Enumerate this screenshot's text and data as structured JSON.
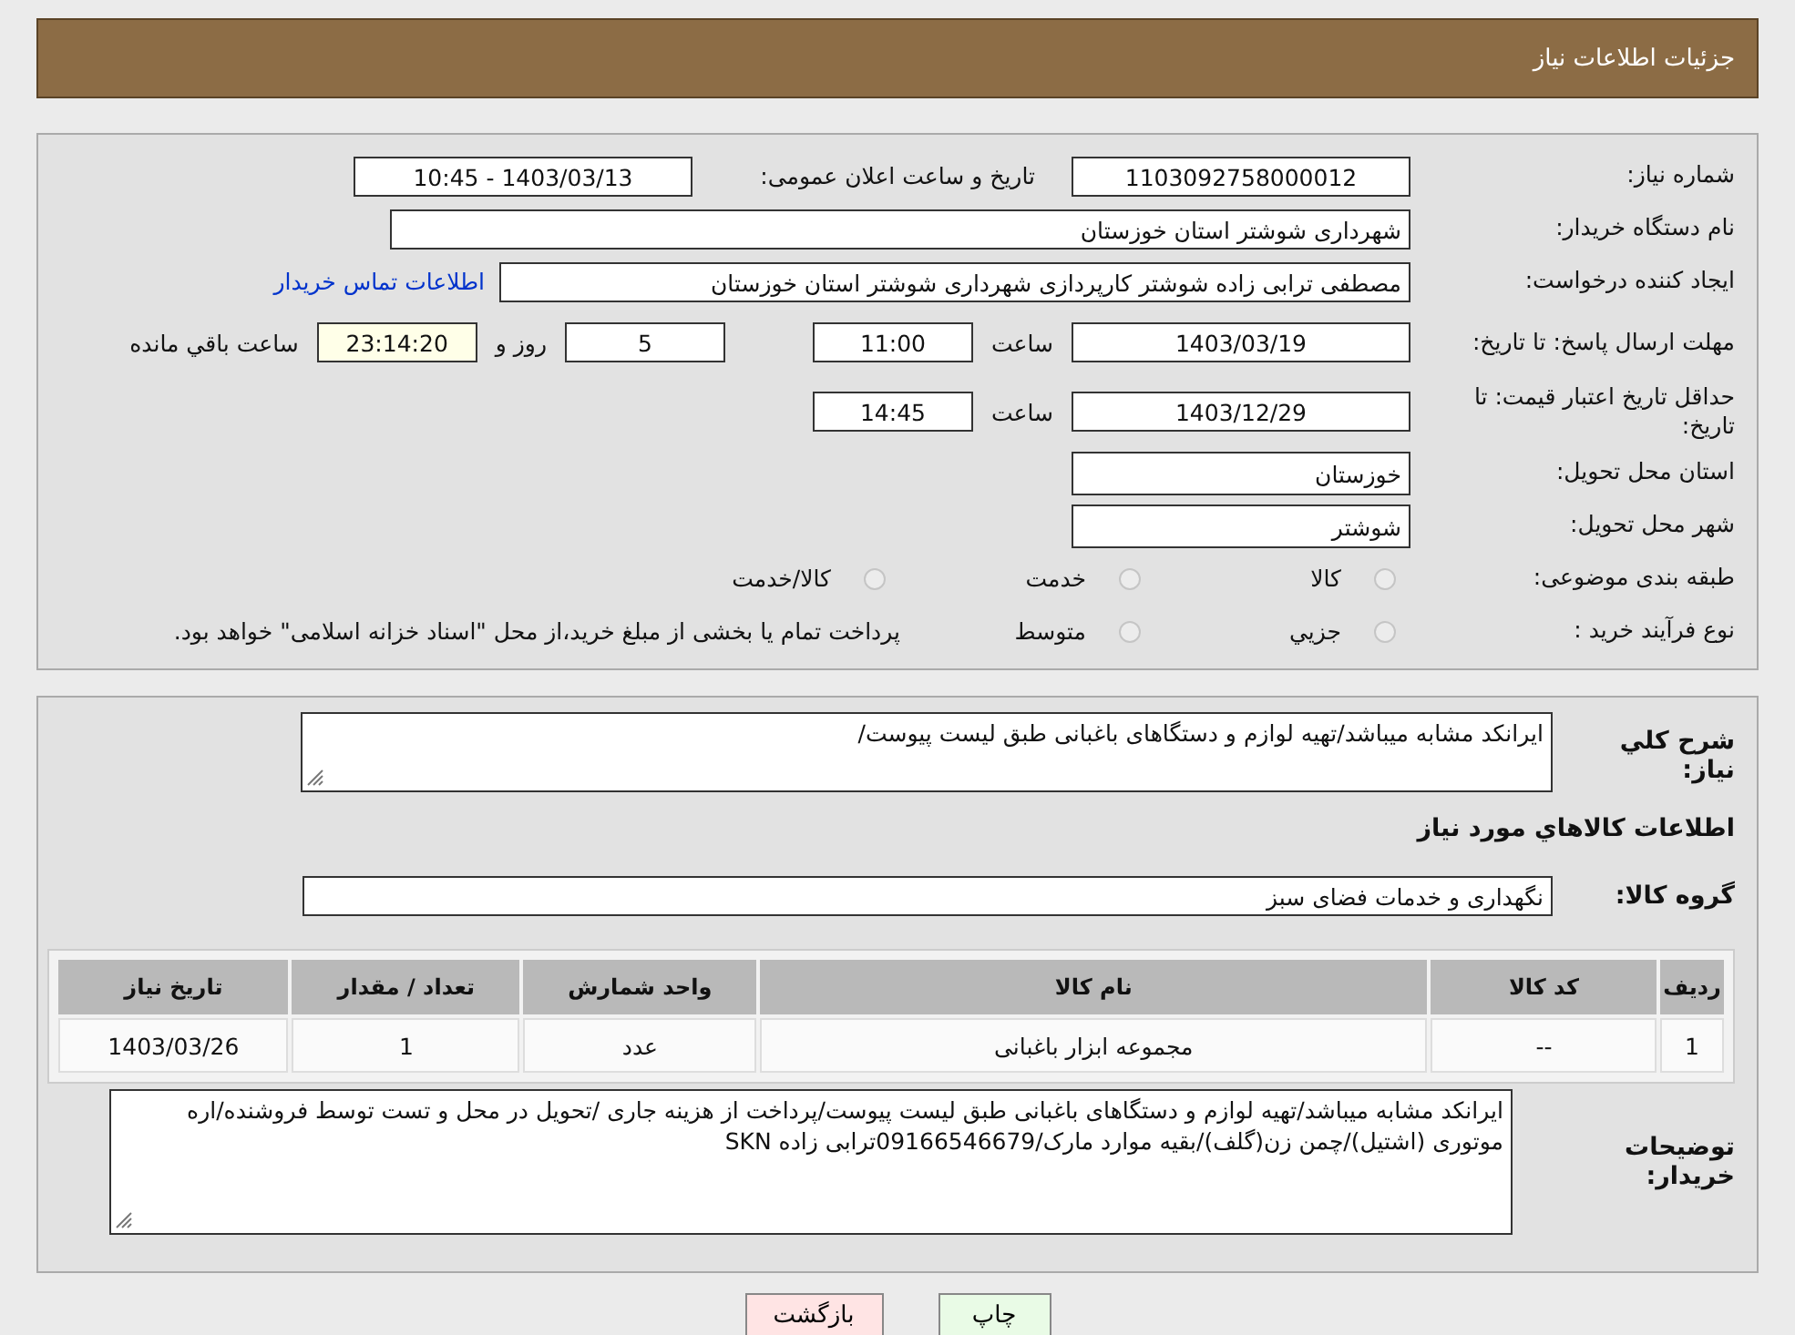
{
  "header": {
    "title": "جزئیات اطلاعات نیاز"
  },
  "details": {
    "need_number": {
      "label": "شماره نیاز:",
      "value": "1103092758000012"
    },
    "announce": {
      "label": "تاریخ و ساعت اعلان عمومی:",
      "value": "1403/03/13 - 10:45"
    },
    "buyer_org": {
      "label": "نام دستگاه خریدار:",
      "value": "شهرداری شوشتر استان خوزستان"
    },
    "requester": {
      "label": "ایجاد کننده درخواست:",
      "value": "مصطفی ترابی زاده شوشتر کارپردازی شهرداری شوشتر استان خوزستان",
      "link": "اطلاعات تماس خریدار"
    },
    "reply_deadline": {
      "label": "مهلت ارسال پاسخ: تا تاریخ:",
      "date": "1403/03/19",
      "time_label": "ساعت",
      "time": "11:00",
      "days": "5",
      "days_label": "روز و",
      "remaining": "23:14:20",
      "remaining_label": "ساعت باقي مانده"
    },
    "price_validity": {
      "label": "حداقل تاریخ اعتبار قیمت: تا تاریخ:",
      "date": "1403/12/29",
      "time_label": "ساعت",
      "time": "14:45"
    },
    "province": {
      "label": "استان محل تحویل:",
      "value": "خوزستان"
    },
    "city": {
      "label": "شهر محل تحویل:",
      "value": "شوشتر"
    },
    "category": {
      "label": "طبقه بندی موضوعی:",
      "options": [
        {
          "label": "كالا",
          "selected": false
        },
        {
          "label": "خدمت",
          "selected": false
        },
        {
          "label": "كالا/خدمت",
          "selected": false
        }
      ]
    },
    "purchase_type": {
      "label": "نوع فرآیند خرید :",
      "options": [
        {
          "label": "جزيي",
          "selected": false
        },
        {
          "label": "متوسط",
          "selected": false
        }
      ],
      "note": "پرداخت تمام یا بخشی از مبلغ خرید،از محل \"اسناد خزانه اسلامی\" خواهد بود."
    }
  },
  "summary": {
    "label": "شرح کلي نیاز:",
    "value": "ایرانکد مشابه میباشد/تهیه لوازم و دستگاهای باغبانی طبق لیست پیوست/"
  },
  "goods_heading": "اطلاعات کالاهاي مورد نیاز",
  "goods_group": {
    "label": "گروه کالا:",
    "value": "نگهداری و خدمات فضای سبز"
  },
  "table": {
    "columns": [
      "ردیف",
      "کد کالا",
      "نام کالا",
      "واحد شمارش",
      "تعداد / مقدار",
      "تاریخ نیاز"
    ],
    "rows": [
      [
        "1",
        "--",
        "مجموعه ابزار باغبانی",
        "عدد",
        "1",
        "1403/03/26"
      ]
    ]
  },
  "buyer_notes": {
    "label": "توضیحات خریدار:",
    "value": "ایرانکد مشابه میباشد/تهیه لوازم و دستگاهای باغبانی طبق لیست پیوست/پرداخت از هزینه جاری /تحویل در محل و تست توسط فروشنده/اره موتوری (اشتیل)/چمن زن(گلف)/بقیه موارد مارک/09166546679ترابی زاده SKN"
  },
  "buttons": [
    {
      "label": "چاپ",
      "kind": "print"
    },
    {
      "label": "بازگشت",
      "kind": "back"
    }
  ]
}
